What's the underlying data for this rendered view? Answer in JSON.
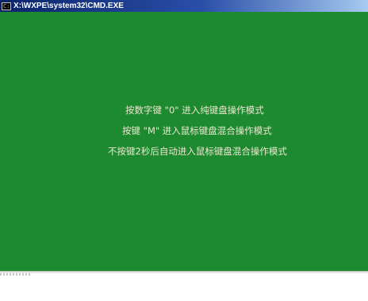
{
  "window": {
    "title": "X:\\WXPE\\system32\\CMD.EXE",
    "icon": "cmd-window-icon",
    "icon_glyph": "C:\\"
  },
  "console": {
    "background_color": "#1e8a2f",
    "text_color": "#e9e6d0",
    "lines": [
      "按数字键 \"0\" 进入纯键盘操作模式",
      "按键 \"M\" 进入鼠标键盘混合操作模式",
      "不按键2秒后自动进入鼠标键盘混合操作模式"
    ]
  }
}
